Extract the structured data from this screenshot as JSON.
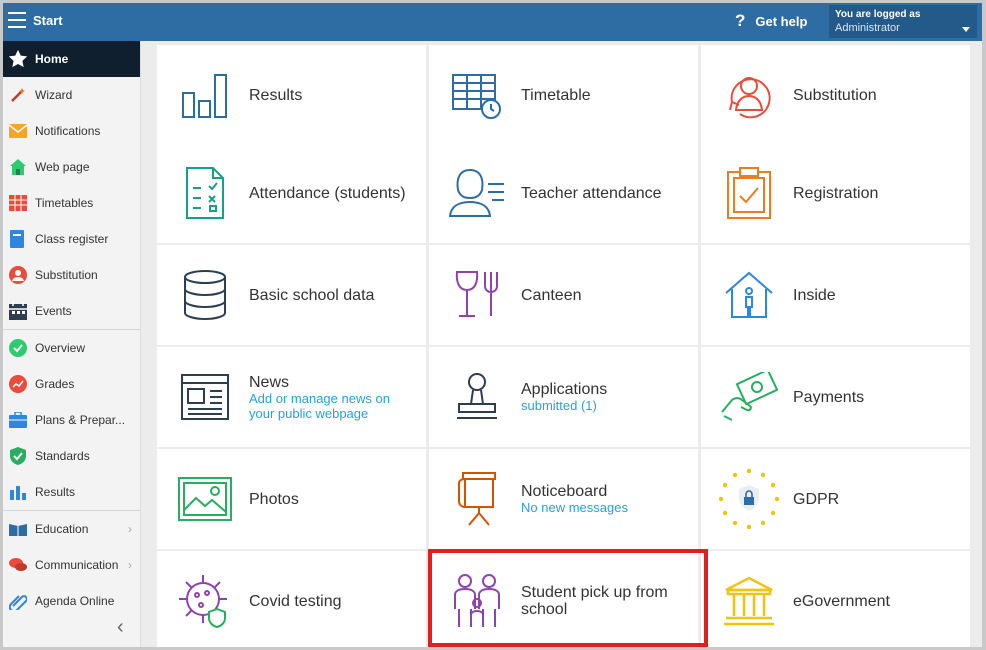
{
  "topbar": {
    "title": "Start",
    "help_label": "Get help",
    "help_icon": "question-icon",
    "user_line1": "You are logged as",
    "user_line2": "Administrator"
  },
  "sidebar": {
    "items": [
      {
        "label": "Home",
        "icon": "star-icon"
      },
      {
        "label": "Wizard",
        "icon": "wand-icon"
      },
      {
        "label": "Notifications",
        "icon": "envelope-icon"
      },
      {
        "label": "Web page",
        "icon": "house-icon"
      },
      {
        "label": "Timetables",
        "icon": "grid-icon"
      },
      {
        "label": "Class register",
        "icon": "book-icon"
      },
      {
        "label": "Substitution",
        "icon": "person-icon"
      },
      {
        "label": "Events",
        "icon": "calendar-icon"
      },
      {
        "label": "Overview",
        "icon": "check-circle-icon"
      },
      {
        "label": "Grades",
        "icon": "chart-circle-icon"
      },
      {
        "label": "Plans & Prepar...",
        "icon": "briefcase-icon"
      },
      {
        "label": "Standards",
        "icon": "shield-check-icon"
      },
      {
        "label": "Results",
        "icon": "bars-icon"
      },
      {
        "label": "Education",
        "icon": "books-icon"
      },
      {
        "label": "Communication",
        "icon": "chat-icon"
      },
      {
        "label": "Agenda Online",
        "icon": "paperclip-icon"
      }
    ]
  },
  "tiles": [
    {
      "title": "Results",
      "sub": "",
      "icon": "bar-chart-icon"
    },
    {
      "title": "Timetable",
      "sub": "",
      "icon": "timetable-icon"
    },
    {
      "title": "Substitution",
      "sub": "",
      "icon": "substitution-icon"
    },
    {
      "title": "Attendance (students)",
      "sub": "",
      "icon": "attendance-icon"
    },
    {
      "title": "Teacher attendance",
      "sub": "",
      "icon": "teacher-attendance-icon"
    },
    {
      "title": "Registration",
      "sub": "",
      "icon": "clipboard-icon"
    },
    {
      "title": "Basic school data",
      "sub": "",
      "icon": "database-icon"
    },
    {
      "title": "Canteen",
      "sub": "",
      "icon": "canteen-icon"
    },
    {
      "title": "Inside",
      "sub": "",
      "icon": "inside-icon"
    },
    {
      "title": "News",
      "sub": "Add or manage news on your public webpage",
      "icon": "news-icon"
    },
    {
      "title": "Applications",
      "sub": "submitted (1)",
      "icon": "stamp-icon"
    },
    {
      "title": "Payments",
      "sub": "",
      "icon": "money-icon"
    },
    {
      "title": "Photos",
      "sub": "",
      "icon": "photo-icon"
    },
    {
      "title": "Noticeboard",
      "sub": "No new messages",
      "icon": "noticeboard-icon"
    },
    {
      "title": "GDPR",
      "sub": "",
      "icon": "gdpr-icon"
    },
    {
      "title": "Covid testing",
      "sub": "",
      "icon": "virus-icon"
    },
    {
      "title": "Student pick up from school",
      "sub": "",
      "icon": "family-icon"
    },
    {
      "title": "eGovernment",
      "sub": "",
      "icon": "government-icon"
    }
  ],
  "colors": {
    "topbar": "#2e6da4",
    "sidebar_active": "#0f1f2e",
    "link": "#2a9fd8",
    "highlight": "#e02020"
  }
}
